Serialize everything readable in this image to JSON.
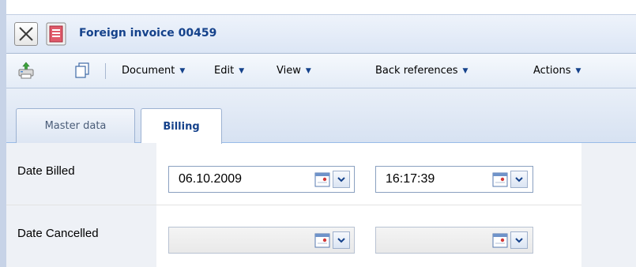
{
  "window": {
    "title": "Foreign invoice 00459"
  },
  "toolbar": {
    "icons": [
      "print-icon",
      "copy-icon"
    ],
    "menus": [
      {
        "label": "Document"
      },
      {
        "label": "Edit"
      },
      {
        "label": "View"
      },
      {
        "label": "Back references"
      },
      {
        "label": "Actions"
      }
    ],
    "menu_arrow": "▼"
  },
  "tabs": [
    {
      "label": "Master data",
      "active": false
    },
    {
      "label": "Billing",
      "active": true
    }
  ],
  "form": {
    "date_billed": {
      "label": "Date Billed",
      "date_value": "06.10.2009",
      "time_value": "16:17:39"
    },
    "date_cancelled": {
      "label": "Date Cancelled",
      "date_value": "",
      "time_value": ""
    }
  },
  "colors": {
    "title_text": "#15428b",
    "accent": "#99bbe8",
    "label_bg": "#eef1f6"
  }
}
